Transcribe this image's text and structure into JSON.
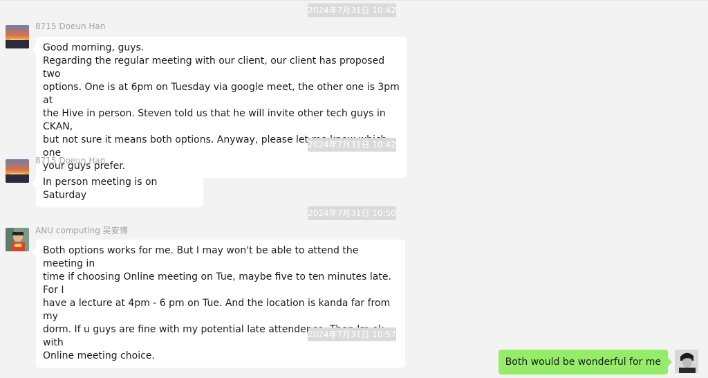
{
  "messages": [
    {
      "timestamp": "2024年7月31日 10:42",
      "sender": "8715 Doeun Han",
      "lines": [
        "Good morning, guys.",
        "Regarding the regular meeting with our client, our client has proposed two",
        "options. One is at 6pm on Tuesday via google meet, the other one is 3pm at",
        "the Hive in person. Steven told us that he will invite other tech guys in CKAN,",
        "but not sure it means both options. Anyway, please let me know which one",
        "your guys prefer."
      ]
    },
    {
      "timestamp": "2024年7月31日 10:42",
      "sender": "8715 Doeun Han",
      "lines": [
        "In person meeting is on Saturday"
      ]
    },
    {
      "timestamp": "2024年7月31日 10:50",
      "sender": "ANU computing 吴安博",
      "lines": [
        "Both options works for me. But I may won't be able to attend the meeting in",
        "time if choosing Online meeting on Tue, maybe five to ten minutes late. For I",
        "have a lecture at 4pm - 6 pm on Tue. And the location is kanda far from my",
        "dorm. If u guys are fine with my potential late attendence. Then Im ok with",
        "Online meeting choice."
      ]
    },
    {
      "timestamp": "2024年7月31日 10:57",
      "sender": "",
      "text": "Both would be wonderful for me"
    }
  ],
  "colors": {
    "background": "#f3f3f3",
    "bubble_incoming": "#ffffff",
    "bubble_outgoing": "#95ec69",
    "timestamp_bg": "#dadada",
    "sender_text": "#a3a3a3"
  },
  "icons": {
    "avatar_1": "sunset-avatar-icon",
    "avatar_2": "person-avatar-icon",
    "avatar_self": "portrait-avatar-icon"
  }
}
